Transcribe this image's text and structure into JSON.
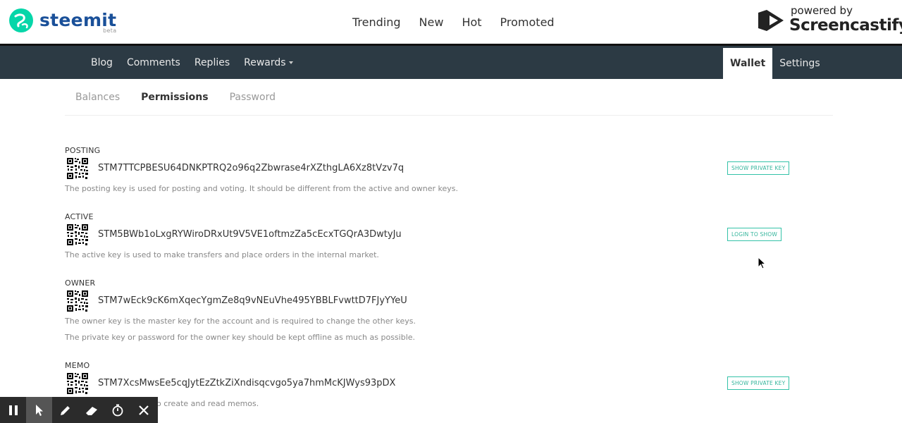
{
  "header": {
    "logo_text": "steemit",
    "logo_badge": "beta",
    "nav": [
      "Trending",
      "New",
      "Hot",
      "Promoted"
    ],
    "overlay_small": "powered by",
    "overlay_big": "Screencastify"
  },
  "usernav": {
    "left": [
      "Blog",
      "Comments",
      "Replies",
      "Rewards"
    ],
    "right": [
      "Wallet",
      "Settings"
    ],
    "active": "Wallet"
  },
  "tabs": {
    "items": [
      "Balances",
      "Permissions",
      "Password"
    ],
    "active": "Permissions"
  },
  "keys": [
    {
      "label": "POSTING",
      "public_key": "STM7TTCPBESU64DNKPTRQ2o96q2Zbwrase4rXZthgLA6Xz8tVzv7q",
      "button": "SHOW PRIVATE KEY",
      "description": [
        "The posting key is used for posting and voting. It should be different from the active and owner keys."
      ]
    },
    {
      "label": "ACTIVE",
      "public_key": "STM5BWb1oLxgRYWiroDRxUt9V5VE1oftmzZa5cEcxTGQrA3DwtyJu",
      "button": "LOGIN TO SHOW",
      "description": [
        "The active key is used to make transfers and place orders in the internal market."
      ]
    },
    {
      "label": "OWNER",
      "public_key": "STM7wEck9cK6mXqecYgmZe8q9vNEuVhe495YBBLFvwttD7FJyYYeU",
      "button": "",
      "description": [
        "The owner key is the master key for the account and is required to change the other keys.",
        "The private key or password for the owner key should be kept offline as much as possible."
      ]
    },
    {
      "label": "MEMO",
      "public_key": "STM7XcsMwsEe5cqJytEzZtkZiXndisqcvgo5ya7hmMcKJWys93pDX",
      "button": "SHOW PRIVATE KEY",
      "description": [
        "o create and read memos."
      ]
    }
  ],
  "recorder_tools": [
    "pause-icon",
    "pointer-icon",
    "pen-icon",
    "eraser-icon",
    "timer-icon",
    "close-icon"
  ],
  "colors": {
    "brand_blue": "#1a5099",
    "brand_teal": "#06d6a9",
    "nav_dark": "#2c3a44",
    "button_teal": "#34b59c"
  }
}
